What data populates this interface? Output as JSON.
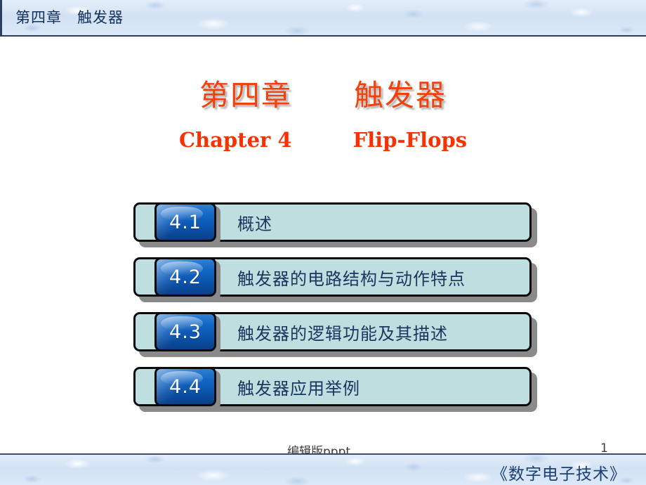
{
  "header": {
    "title": "第四章　触发器"
  },
  "title_block": {
    "main_title": "第四章　　触发器",
    "sub_title": "Chapter 4　　　Flip-Flops"
  },
  "agenda": {
    "rows": [
      {
        "number": "4.1",
        "label": "概述"
      },
      {
        "number": "4.2",
        "label": "触发器的电路结构与动作特点"
      },
      {
        "number": "4.3",
        "label": "触发器的逻辑功能及其描述"
      },
      {
        "number": "4.4",
        "label": "触发器应用举例"
      }
    ]
  },
  "watermark": {
    "text": "编辑版pppt"
  },
  "page_number": "1",
  "footer": {
    "title": "《数字电子技术》"
  },
  "colors": {
    "title_orange": "#f4400b",
    "subtitle_red": "#fa3000",
    "label_navy": "#18365e",
    "box_fill": "#bfdee0",
    "badge_blue": "#0b55b0",
    "bar_blue": "#dce8f7",
    "header_border": "#2c3e62"
  }
}
